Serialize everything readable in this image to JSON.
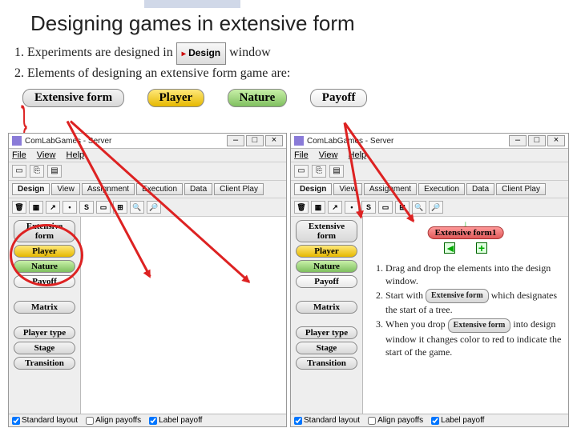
{
  "title": "Designing games in extensive form",
  "intro": {
    "line1a": "1.  Experiments are designed in ",
    "line1b": " window",
    "line2": "2.  Elements of designing an extensive form game are:",
    "design_label": "Design"
  },
  "element_chips": [
    "Extensive form",
    "Player",
    "Nature",
    "Payoff"
  ],
  "app": {
    "title": "ComLabGames - Server",
    "menus": [
      "File",
      "View",
      "Help"
    ],
    "tabs": [
      "Design",
      "View",
      "Assignment",
      "Execution",
      "Data",
      "Client Play"
    ],
    "palette": [
      "Extensive form",
      "Player",
      "Nature",
      "Payoff",
      "Matrix",
      "Player type",
      "Stage",
      "Transition"
    ],
    "win_buttons": [
      "–",
      "□",
      "×"
    ],
    "status": {
      "std": "Standard layout",
      "align": "Align payoffs",
      "label": "Label payoff"
    }
  },
  "drop_label": "Extensive form1",
  "instructions": {
    "i1": "Drag and drop the elements into the design window.",
    "i2a": "Start with ",
    "i2b": " which designates the start of a tree.",
    "i3a": "When you drop ",
    "i3b": " into design window it changes color to red to indicate the start of the game.",
    "chip_ef": "Extensive form"
  }
}
